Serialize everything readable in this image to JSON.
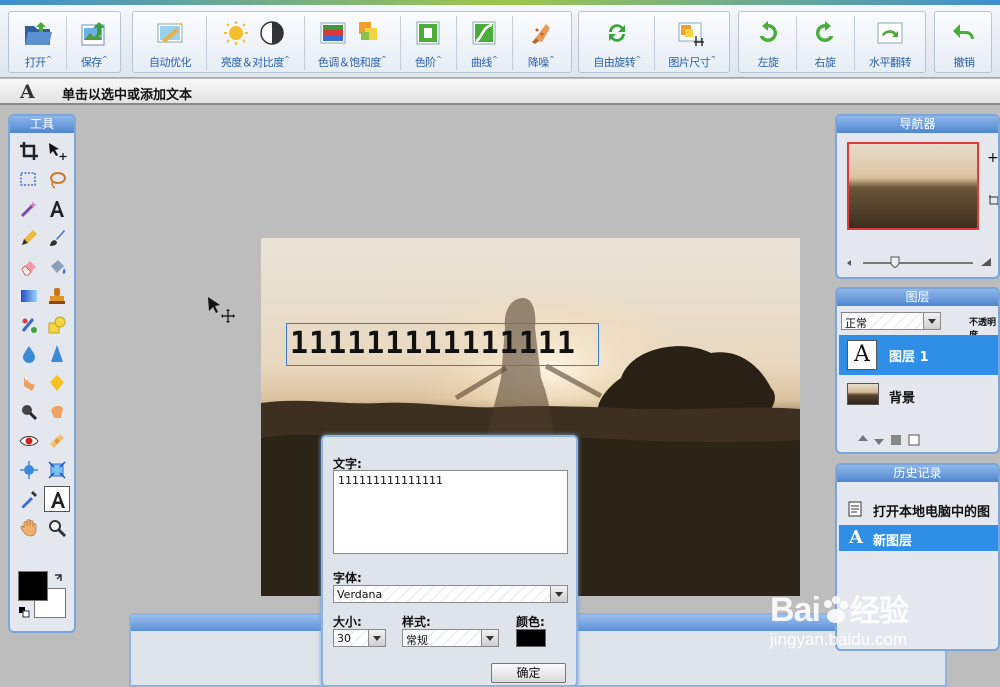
{
  "toolbar": {
    "open": "打开",
    "save": "保存",
    "auto_optimize": "自动优化",
    "brightness_contrast": "亮度＆对比度",
    "hue_saturation": "色调＆饱和度",
    "levels": "色阶",
    "curves": "曲线",
    "denoise": "降噪",
    "free_rotate": "自由旋转",
    "image_size": "图片尺寸",
    "rotate_left": "左旋",
    "rotate_right": "右旋",
    "flip_horizontal": "水平翻转",
    "undo": "撤销",
    "menu_marker": "^"
  },
  "hint": {
    "icon": "A",
    "text": "单击以选中或添加文本"
  },
  "tools_panel": {
    "title": "工具"
  },
  "canvas": {
    "text_content": "111111111111111"
  },
  "text_dialog": {
    "text_label": "文字:",
    "text_value": "111111111111111",
    "font_label": "字体:",
    "font_value": "Verdana",
    "size_label": "大小:",
    "size_value": "30",
    "style_label": "样式:",
    "style_value": "常规",
    "color_label": "颜色:",
    "color_value": "#000000",
    "ok_button": "确定"
  },
  "navigator": {
    "title": "导航器",
    "zoom_in": "+"
  },
  "layers_panel": {
    "title": "图层",
    "blend_mode": "正常",
    "opacity_label": "不透明度",
    "layers": [
      {
        "name": "图层 1",
        "thumb": "A"
      },
      {
        "name": "背景"
      }
    ]
  },
  "history_panel": {
    "title": "历史记录",
    "items": [
      {
        "label": "打开本地电脑中的图"
      },
      {
        "label": "新图层"
      }
    ]
  },
  "watermark": {
    "brand": "Bai",
    "brand_cn": "经验",
    "url": "jingyan.baidu.com"
  },
  "colors": {
    "accent": "#3b7ddd",
    "selected_row": "#2f8ee6",
    "foreground": "#000000",
    "background": "#ffffff"
  }
}
